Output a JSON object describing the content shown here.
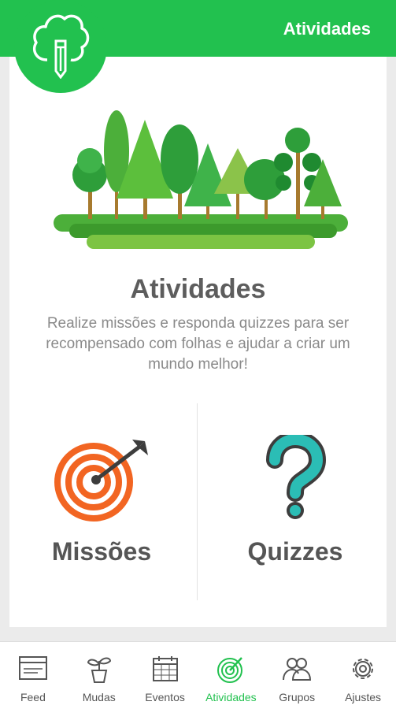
{
  "header": {
    "title": "Atividades"
  },
  "colors": {
    "brand": "#22c14f",
    "target": "#f26522",
    "question": "#2bbdb5",
    "text": "#5d5d5d"
  },
  "main": {
    "title": "Atividades",
    "description": "Realize missões e responda quizzes para ser recompensado com folhas e ajudar a criar um mundo melhor!"
  },
  "options": {
    "missions": {
      "label": "Missões",
      "icon": "target-arrow-icon"
    },
    "quizzes": {
      "label": "Quizzes",
      "icon": "question-mark-icon"
    }
  },
  "nav": {
    "active": "Atividades",
    "items": [
      {
        "label": "Feed",
        "icon": "browser-window-icon"
      },
      {
        "label": "Mudas",
        "icon": "plant-pot-icon"
      },
      {
        "label": "Eventos",
        "icon": "calendar-icon"
      },
      {
        "label": "Atividades",
        "icon": "target-icon"
      },
      {
        "label": "Grupos",
        "icon": "people-icon"
      },
      {
        "label": "Ajustes",
        "icon": "gear-icon"
      }
    ]
  }
}
